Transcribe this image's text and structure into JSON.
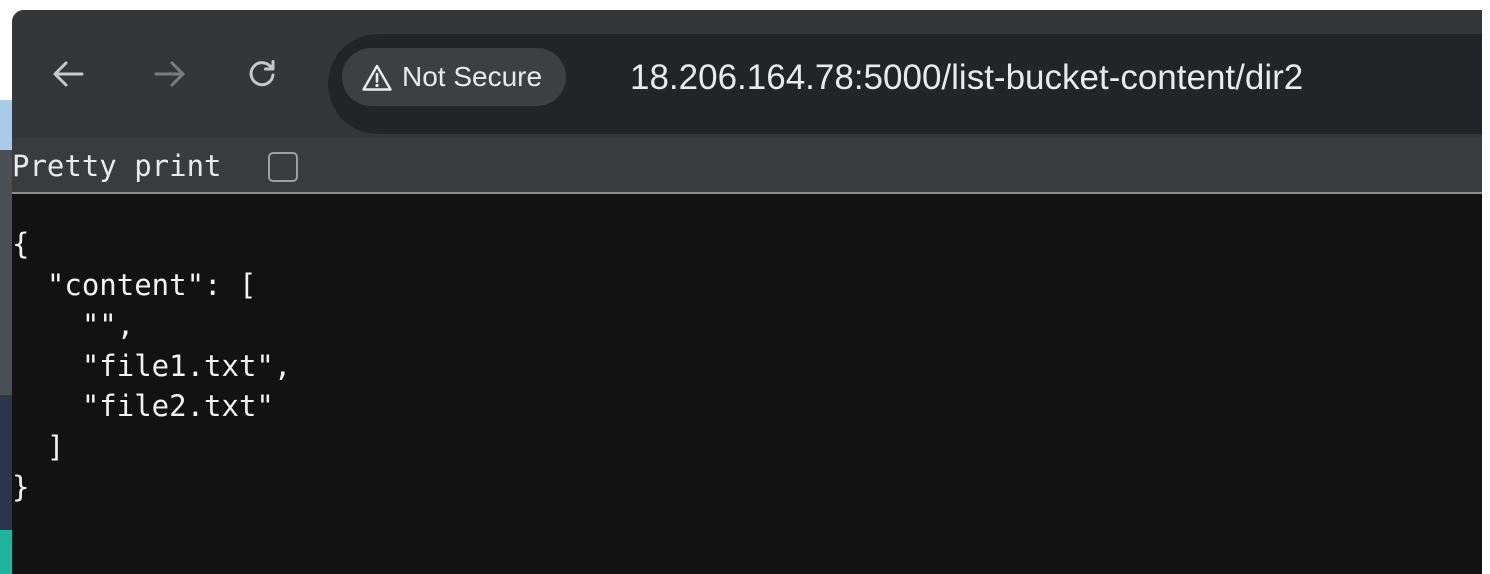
{
  "browser": {
    "nav": {
      "back_icon": "arrow-left-icon",
      "forward_icon": "arrow-right-icon",
      "reload_icon": "reload-icon"
    },
    "security_chip": {
      "icon": "warning-triangle-icon",
      "label": "Not Secure"
    },
    "url": {
      "host": "18.206.164.78",
      "path": ":5000/list-bucket-content/dir2"
    }
  },
  "viewer": {
    "pretty_print_label": "Pretty print",
    "pretty_print_checked": false
  },
  "json_lines": [
    "{",
    "  \"content\": [",
    "    \"\",",
    "    \"file1.txt\",",
    "    \"file2.txt\"",
    "  ]",
    "}"
  ],
  "colors": {
    "toolbar": "#343638",
    "omnibox": "#232425",
    "chip": "#3d3f41",
    "page_background": "#121212",
    "pretty_bar": "#3a3b3c",
    "text": "#e8eaed"
  }
}
